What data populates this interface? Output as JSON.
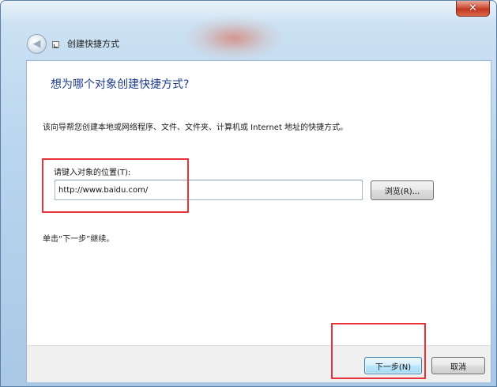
{
  "window": {
    "title": "创建快捷方式",
    "close_glyph": "✕",
    "back_glyph": "◀",
    "icon_back": "back-arrow-icon",
    "icon_wizard": "shortcut-wizard-icon"
  },
  "page": {
    "heading": "想为哪个对象创建快捷方式?",
    "description": "该向导帮您创建本地或网络程序、文件、文件夹、计算机或 Internet 地址的快捷方式。",
    "location_label": "请键入对象的位置(T):",
    "location_value": "http://www.baidu.com/",
    "browse_label": "浏览(R)...",
    "continue_hint": "单击“下一步”继续。"
  },
  "footer": {
    "next_label": "下一步(N)",
    "cancel_label": "取消"
  },
  "colors": {
    "heading": "#1e3c8c",
    "highlight": "#e8333a",
    "close_button": "#c2371f"
  }
}
